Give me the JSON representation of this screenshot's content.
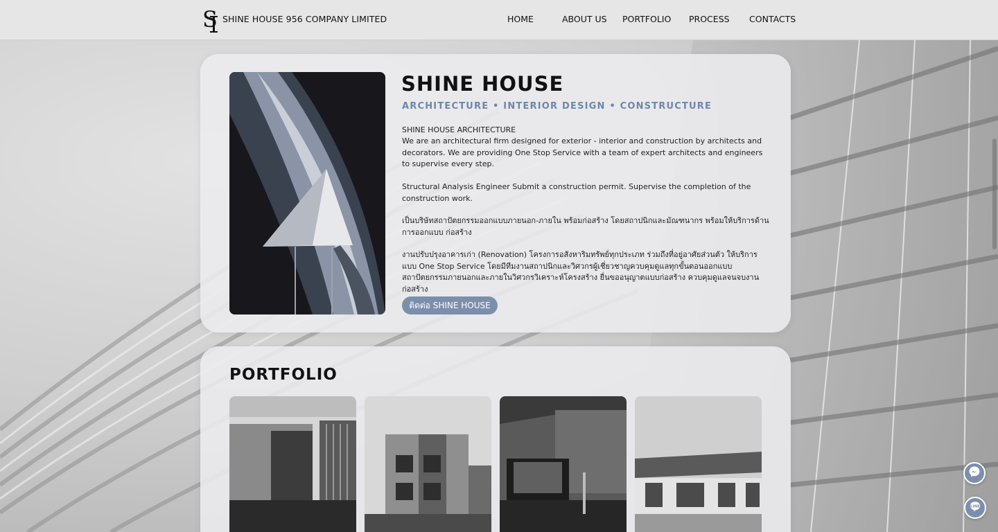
{
  "nav": {
    "brand": "SHINE HOUSE 956 COMPANY LIMITED",
    "items": [
      "HOME",
      "ABOUT US",
      "PORTFOLIO",
      "PROCESS",
      "CONTACTS"
    ]
  },
  "about": {
    "title": "SHINE HOUSE",
    "subtitle": "ARCHITECTURE • INTERIOR DESIGN • CONSTRUCTURE",
    "p1_heading": "SHINE HOUSE ARCHITECTURE",
    "p1_body": "We are an architectural firm designed for exterior - interior and construction by architects and decorators. We are providing One Stop Service with a team of expert architects and engineers to supervise every step.",
    "p2": "Structural Analysis Engineer Submit a construction permit. Supervise the completion of the construction work.",
    "p3": "เป็นบริษัทสถาปัตยกรรมออกแบบภายนอก-ภายใน พร้อมก่อสร้าง โดยสถาปนิกและมัณฑนากร พร้อมให้บริการด้านการออกแบบ ก่อสร้าง",
    "p4": "งานปรับปรุงอาคารเก่า (Renovation) โครงการอสังหาริมทรัพย์ทุกประเภท ร่วมถึงที่อยู่อาศัยส่วนตัว ให้บริการแบบ One Stop Service  โดยมีทีมงานสถาปนิกและวิศวกรผู้เชี่ยวชาญควบคุมดูแลทุกขั้นตอนออกแบบสถาปัตยกรรมภายนอกและภายในวิศวกรวิเคราะห์โครงสร้าง ยื่นขออนุญาตแบบก่อสร้าง ควบคุมดูแลจนจบงานก่อสร้าง",
    "button": "ติดต่อ SHINE HOUSE"
  },
  "portfolio": {
    "title": "PORTFOLIO"
  },
  "icons": {
    "messenger": "messenger-icon",
    "line": "line-icon"
  },
  "colors": {
    "accent": "#7b8fad",
    "nav_bg": "#e6e6e6"
  }
}
